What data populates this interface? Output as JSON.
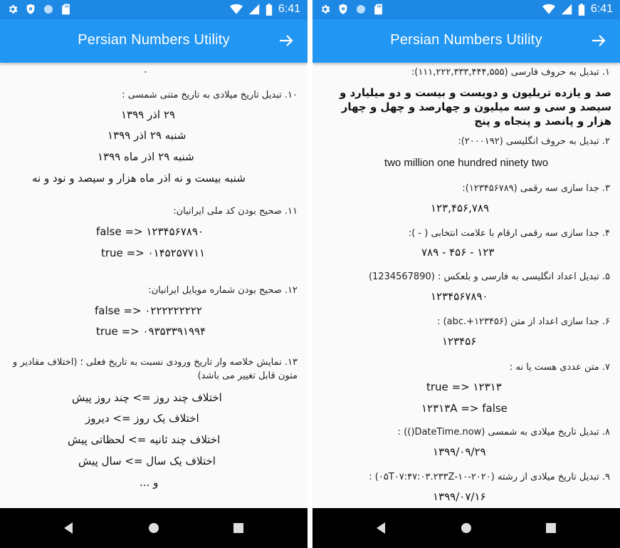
{
  "app": {
    "title": "Persian Numbers Utility",
    "status_time": "6:41",
    "colors": {
      "appbar": "#2196f3",
      "statusbar": "#1e88e5",
      "navbar": "#000000"
    },
    "icons": [
      "gear-icon",
      "shield-icon",
      "circle-icon",
      "sd-card-icon",
      "wifi-icon",
      "cellular-icon",
      "battery-icon",
      "arrow-forward-icon",
      "back-icon",
      "home-icon",
      "recents-icon"
    ]
  },
  "left": {
    "s10": {
      "title": "۱۰. تبدیل تاریخ میلادی به تاریخ متنی شمسی :",
      "lines": [
        "۲۹ اذر ۱۳۹۹",
        "شنبه ۲۹ اذر ۱۳۹۹",
        "شنبه ۲۹ اذر ماه ۱۳۹۹",
        "شنبه بیست و نه اذر ماه هزار و سیصد و نود و نه"
      ]
    },
    "s11": {
      "title": "۱۱. صحیح بودن کد ملی ایرانیان:",
      "lines": [
        "۱۲۳۴۵۶۷۸۹۰ <= false",
        "۰۱۴۵۲۵۷۷۱۱ <= true"
      ]
    },
    "s12": {
      "title": "۱۲. صحیح بودن شماره موبایل ایرانیان:",
      "lines": [
        "۰۲۲۲۲۲۲۲۲۲ <= false",
        "۰۹۳۵۳۳۹۱۹۹۴ <= true"
      ]
    },
    "s13": {
      "title": "۱۳. نمایش خلاصه وار تاریخ ورودی نسبت به تاریخ فعلی ؛ (اختلاف مقادیر و متون قابل تغییر می باشد)",
      "lines": [
        "اختلاف چند روز => چند روز پیش",
        "اختلاف یک روز => دیروز",
        "اختلاف چند ثانیه => لحظاتی پیش",
        "اختلاف یک سال => سال پیش",
        "و ..."
      ]
    }
  },
  "right": {
    "s1": {
      "title": "۱. تبدیل به حروف فارسی (۱۱۱,۲۲۲,۳۳۳,۴۴۴,۵۵۵):",
      "body": "صد و یازده تریلیون و دویست و بیست و دو میلیارد و سیصد و سی و سه میلیون و چهارصد و چهل و چهار هزار و پانصد و پنجاه و پنج"
    },
    "s2": {
      "title": "۲. تبدیل به حروف انگلیسی (۲۰۰۰۱۹۲):",
      "value": "two million  one hundred ninety two"
    },
    "s3": {
      "title": "۳. جدا سازی سه رقمی (۱۲۳۴۵۶۷۸۹):",
      "value": "۱۲۳,۴۵۶,۷۸۹"
    },
    "s4": {
      "title": "۴. جدا سازی سه رقمی ارقام با علامت انتخابی ( - ):",
      "value": "۱۲۳ - ۴۵۶ - ۷۸۹"
    },
    "s5": {
      "title": "۵. تبدیل اعداد انگلیسی به فارسی و بلعکس : (1234567890)",
      "value": "۱۲۳۴۵۶۷۸۹۰"
    },
    "s6": {
      "title": "۶. جدا سازی اعداد از متن (abc.+۱۲۳۴۵۶) :",
      "value": "۱۲۳۴۵۶"
    },
    "s7": {
      "title": "۷. متن عددی هست یا نه :",
      "lines": [
        "۱۲۳۱۳ <= true",
        "۱۲۳۱۳A => false"
      ]
    },
    "s8": {
      "title": "۸. تبدیل تاریخ میلادی به شمسی (DateTime.now()) :",
      "value": "۱۳۹۹/۰۹/۲۹"
    },
    "s9": {
      "title": "۹. تبدیل تاریخ میلادی از رشته (۲۰۲۰-۱۰-۰۵T۰۷:۴۷:۰۳.۲۳۳Z) :",
      "value": "۱۳۹۹/۰۷/۱۶"
    }
  }
}
